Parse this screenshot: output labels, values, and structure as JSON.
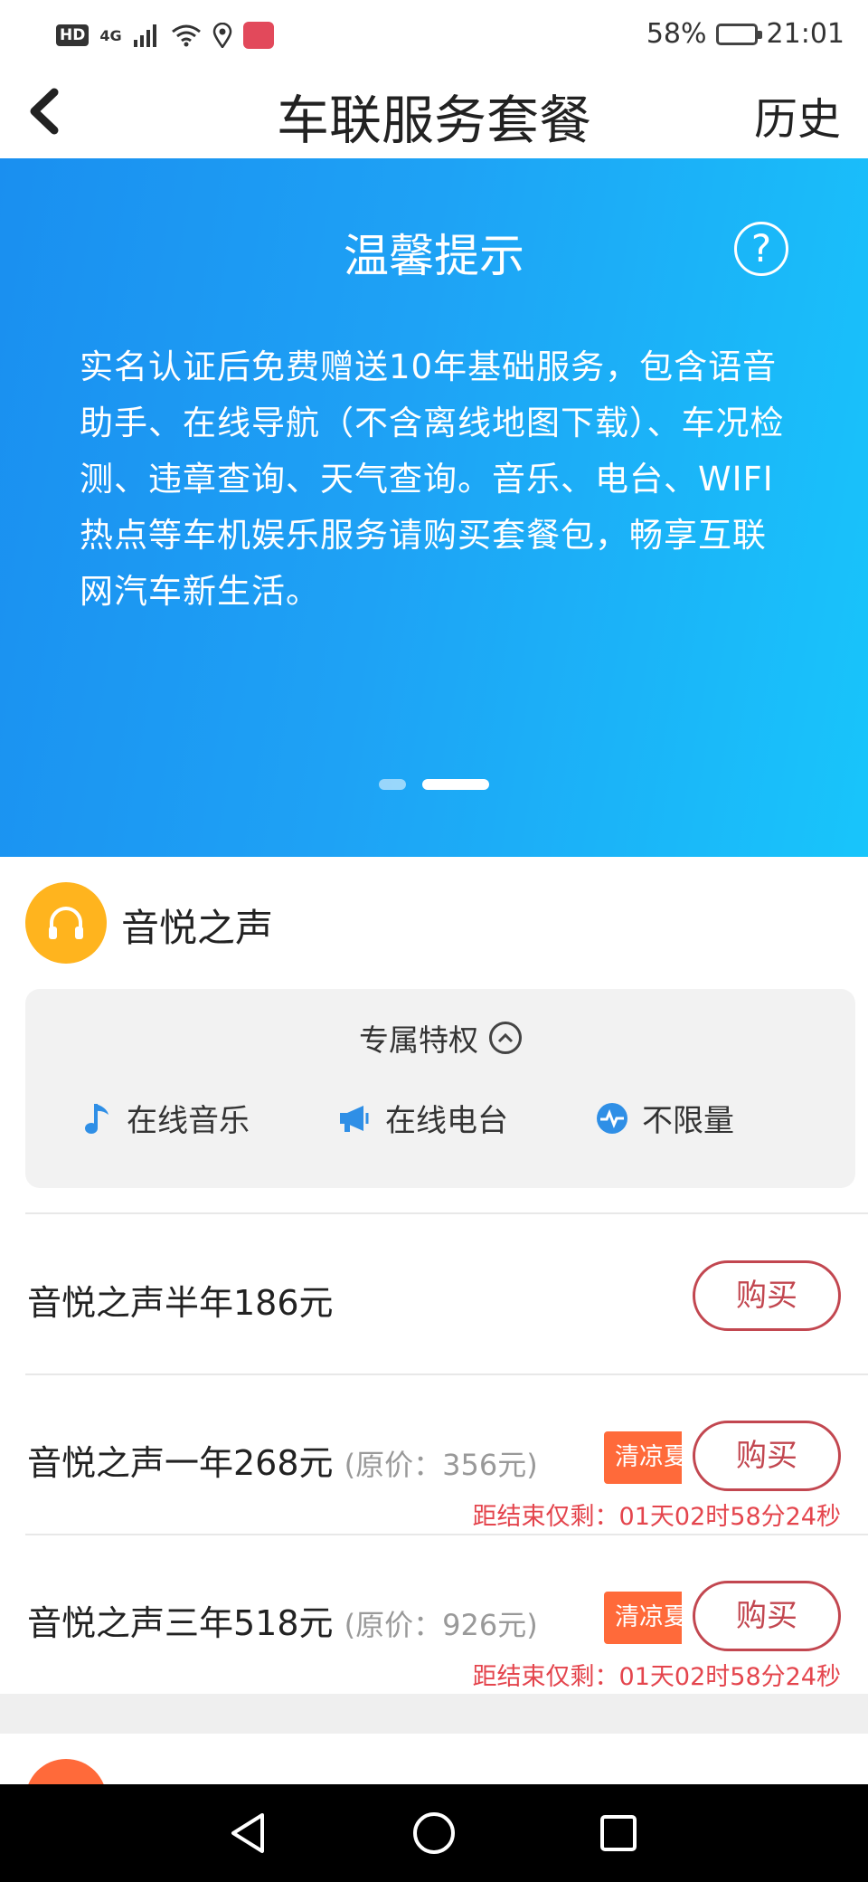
{
  "status_bar": {
    "hd": "HD",
    "network": "4G",
    "battery": "58%",
    "battery_level": 0.58,
    "time": "21:01"
  },
  "nav": {
    "title": "车联服务套餐",
    "history": "历史"
  },
  "banner": {
    "title": "温馨提示",
    "help": "?",
    "text": "实名认证后免费赠送10年基础服务，包含语音助手、在线导航（不含离线地图下载）、车况检测、违章查询、天气查询。音乐、电台、WIFI热点等车机娱乐服务请购买套餐包，畅享互联网汽车新生活。",
    "active_dot": 1
  },
  "package": {
    "name": "音悦之声",
    "perks_title": "专属特权",
    "perks": [
      {
        "label": "在线音乐",
        "icon": "music-note-icon"
      },
      {
        "label": "在线电台",
        "icon": "megaphone-icon"
      },
      {
        "label": "不限量",
        "icon": "pulse-icon"
      }
    ],
    "options": [
      {
        "label": "音悦之声半年186元",
        "buy": "购买"
      },
      {
        "label": "音悦之声一年268元",
        "original": "(原价：356元)",
        "tag": "清凉夏",
        "countdown": "距结束仅剩：01天02时58分24秒",
        "buy": "购买"
      },
      {
        "label": "音悦之声三年518元",
        "original": "(原价：926元)",
        "tag": "清凉夏",
        "countdown": "距结束仅剩：01天02时58分24秒",
        "buy": "购买"
      }
    ]
  },
  "colors": {
    "accent": "#c24750",
    "banner_start": "#1a8ff0",
    "banner_end": "#18c5fb",
    "package_icon": "#ffb41e",
    "promo": "#ff6a3a",
    "countdown": "#e4454d"
  }
}
